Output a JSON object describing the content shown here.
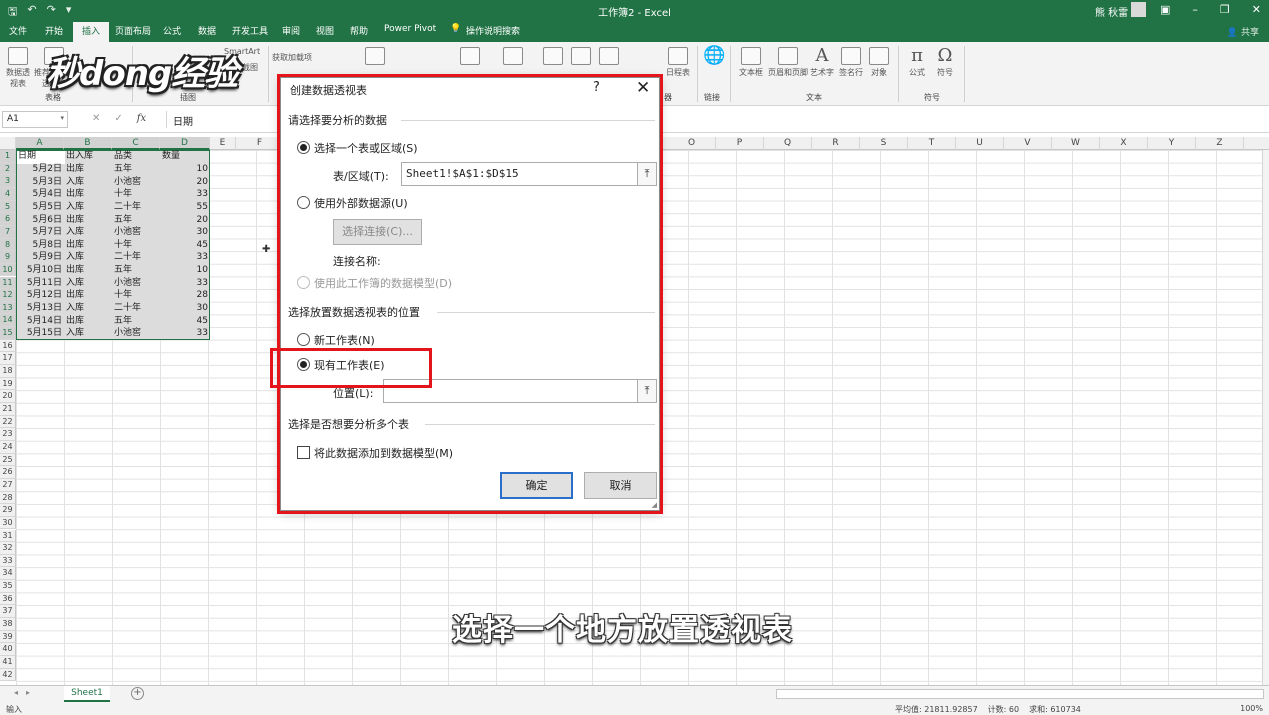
{
  "titlebar": {
    "title": "工作簿2 - Excel",
    "user": "熊 秋雷"
  },
  "ribbon": {
    "tabs": [
      "文件",
      "开始",
      "插入",
      "页面布局",
      "公式",
      "数据",
      "开发工具",
      "审阅",
      "视图",
      "帮助",
      "Power Pivot",
      "操作说明搜索"
    ],
    "active_tab": "插入",
    "share": "共享",
    "buttons": {
      "pivot": "数据透视表",
      "recommended_pivot": "推荐的数据透视表",
      "smartart": "SmartArt",
      "screenshot": "屏幕截图",
      "get_addins": "获取加载项",
      "link": "链接",
      "textbox": "文本框",
      "header_footer": "页眉和页脚",
      "wordart": "艺术字",
      "signature": "签名行",
      "object": "对象",
      "equation": "公式",
      "symbol": "符号",
      "timeline": "日程表"
    },
    "groups": {
      "tables": "表格",
      "illustrations": "插图",
      "links": "链接",
      "text": "文本",
      "symbols": "符号",
      "filter": "器"
    }
  },
  "watermark": "秒dong经验",
  "formula_bar": {
    "cell_ref": "A1",
    "fx": "fx",
    "content": "日期"
  },
  "sheet": {
    "columns": [
      "A",
      "B",
      "C",
      "D",
      "E",
      "F",
      "O",
      "P",
      "Q",
      "R",
      "S",
      "T",
      "U",
      "V",
      "W",
      "X",
      "Y",
      "Z"
    ],
    "header": [
      "日期",
      "出入库",
      "品类",
      "数量"
    ],
    "rows": [
      [
        "5月2日",
        "出库",
        "五年",
        "10"
      ],
      [
        "5月3日",
        "入库",
        "小池窖",
        "20"
      ],
      [
        "5月4日",
        "出库",
        "十年",
        "33"
      ],
      [
        "5月5日",
        "入库",
        "二十年",
        "55"
      ],
      [
        "5月6日",
        "出库",
        "五年",
        "20"
      ],
      [
        "5月7日",
        "入库",
        "小池窖",
        "30"
      ],
      [
        "5月8日",
        "出库",
        "十年",
        "45"
      ],
      [
        "5月9日",
        "入库",
        "二十年",
        "33"
      ],
      [
        "5月10日",
        "出库",
        "五年",
        "10"
      ],
      [
        "5月11日",
        "入库",
        "小池窖",
        "33"
      ],
      [
        "5月12日",
        "出库",
        "十年",
        "28"
      ],
      [
        "5月13日",
        "入库",
        "二十年",
        "30"
      ],
      [
        "5月14日",
        "出库",
        "五年",
        "45"
      ],
      [
        "5月15日",
        "入库",
        "小池窖",
        "33"
      ]
    ],
    "row_count": 42,
    "tab": "Sheet1"
  },
  "dialog": {
    "title": "创建数据透视表",
    "help": "?",
    "section_data": "请选择要分析的数据",
    "opt_table": "选择一个表或区域(S)",
    "range_label": "表/区域(T):",
    "range_value": "Sheet1!$A$1:$D$15",
    "opt_external": "使用外部数据源(U)",
    "choose_conn": "选择连接(C)...",
    "conn_name": "连接名称:",
    "opt_model": "使用此工作簿的数据模型(D)",
    "section_place": "选择放置数据透视表的位置",
    "opt_new": "新工作表(N)",
    "opt_existing": "现有工作表(E)",
    "location_label": "位置(L):",
    "location_value": "",
    "section_multi": "选择是否想要分析多个表",
    "add_model": "将此数据添加到数据模型(M)",
    "ok": "确定",
    "cancel": "取消"
  },
  "subtitle": "选择一个地方放置透视表",
  "status": {
    "mode": "输入",
    "average": "平均值: 21811.92857",
    "count": "计数: 60",
    "sum": "求和: 610734",
    "zoom": "100%"
  }
}
